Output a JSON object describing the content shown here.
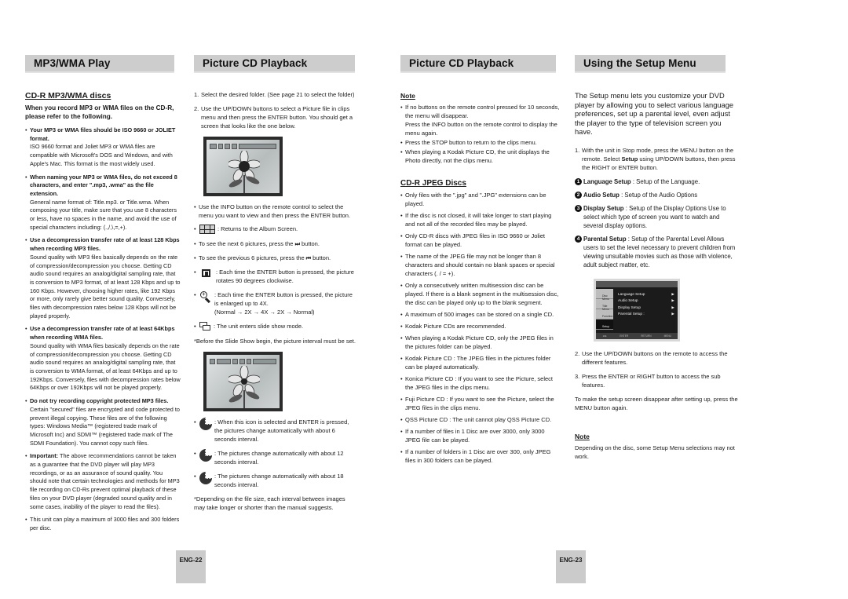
{
  "columns": {
    "mp3wma": {
      "header": "MP3/WMA Play",
      "subheading": "CD-R MP3/WMA discs",
      "lead": "When you record MP3 or WMA files on the CD-R, please refer to the following.",
      "items": [
        {
          "bold": "Your MP3 or WMA files should be ISO 9660 or JOLIET format.",
          "body": "ISO 9660 format and Joliet MP3 or WMA files are compatible with Microsoft's DOS and Windows, and with Apple's Mac. This format is the most widely used."
        },
        {
          "bold": "When naming your MP3 or WMA files, do not exceed 8 characters, and enter \".mp3, .wma\" as the file extension.",
          "body": "General name format of: Title.mp3. or Title.wma. When composing your title, make sure that you use 8 characters or less, have no spaces in the name, and avoid the use of special characters including: (.,/,\\,=,+)."
        },
        {
          "bold": "Use a decompression transfer rate of at least 128 Kbps when recording MP3 files.",
          "body": "Sound quality with MP3 files basically depends on the rate of compression/decompression you choose. Getting CD audio sound requires an analog/digital sampling rate, that is conversion to MP3 format, of at least 128 Kbps and up to 160 Kbps. However, choosing higher rates, like 192 Kbps or more, only rarely give better sound quality. Conversely, files with decompression rates below 128 Kbps will not be played properly."
        },
        {
          "bold": "Use a decompression transfer rate of at least 64Kbps when recording WMA files.",
          "body": "Sound quality with WMA files basically depends on the rate of compression/decompression you choose. Getting CD audio sound requires an analog/digital sampling rate, that is conversion to WMA format, of at least 64Kbps and up to 192Kbps. Conversely, files with decompression rates below 64Kbps or over 192Kbps will not be played properly."
        },
        {
          "bold": "Do not try recording copyright protected MP3 files.",
          "body": "Certain \"secured\" files are encrypted and code protected to prevent illegal copying. These files are of the following types: Windows Media™ (registered trade mark of Microsoft Inc) and SDMI™ (registered trade mark of The SDMI Foundation). You cannot copy such files."
        }
      ],
      "important_label": "Important:",
      "important_text": "The above recommendations cannot be taken as a guarantee that the DVD player will play MP3 recordings, or as an assurance of sound quality. You should note that certain technologies and methods for MP3 file recording on CD-Rs prevent optimal playback of these files on your DVD player (degraded sound quality and in some cases, inability of the player to read the files).",
      "max_text": "This unit can play a maximum of 3000 files and 300 folders per disc."
    },
    "picture_cd_1": {
      "header": "Picture CD Playback",
      "steps": [
        {
          "n": "1.",
          "text": "Select the desired folder. (See page 21 to select the folder)"
        },
        {
          "n": "2.",
          "text": "Use the UP/DOWN buttons to select a Picture file in clips menu and then press the ENTER button. You should get a screen that looks like the one below."
        }
      ],
      "info_text": "Use the INFO button on the remote control to select the menu you want to view and then press the ENTER button.",
      "album_text": ": Returns to the Album Screen.",
      "next_text_a": "To see the next 6 pictures, press the",
      "next_text_b": "button.",
      "prev_text_a": "To see the previous 6 pictures, press the",
      "prev_text_b": "button.",
      "next_glyph": "⏭",
      "prev_glyph": "⏮",
      "rotate_text": ": Each time the ENTER button is pressed, the picture rotates 90 degrees clockwise.",
      "zoom_text": ": Each time the ENTER button is pressed, the picture is enlarged up to 4X.",
      "zoom_seq": "(Normal → 2X → 4X →  2X → Normal)",
      "slide_text": ": The unit enters slide show mode.",
      "slide_note": "*Before the Slide Show begin, the picture interval must be set.",
      "interval_6": ": When this icon is selected and ENTER is pressed, the pictures change automatically with about 6 seconds interval.",
      "interval_12": ": The pictures change automatically with about 12 seconds interval.",
      "interval_18": ": The pictures change automatically with about 18 seconds interval.",
      "interval_note": "*Depending on the file size, each interval between images may take longer or shorter than the manual suggests."
    },
    "picture_cd_2": {
      "header": "Picture CD Playback",
      "note_label": "Note",
      "notes": [
        "If no buttons on the remote control pressed for 10 seconds, the menu will disappear.\nPress the INFO button on the remote control to display the menu again.",
        "Press the STOP button to return to the clips menu.",
        "When playing a Kodak Picture CD, the unit displays the Photo directly, not the clips menu."
      ],
      "jpeg_heading": "CD-R JPEG Discs",
      "jpeg_items": [
        "Only files with the \".jpg\" and \".JPG\" extensions can be played.",
        "If the disc is not closed, it will take longer to start playing and not all of the recorded files may be played.",
        "Only CD-R discs with JPEG files in ISO 9660 or Joliet format can be played.",
        "The name of the JPEG file may not be longer than 8 characters and should contain no blank spaces or special characters (. / = +).",
        "Only a consecutively written multisession disc can be played. If there is a blank segment in the multisession disc, the disc can be played only up to the blank segment.",
        "A maximum of 500 images can be stored on a single CD.",
        "Kodak Picture CDs are recommended.",
        "When playing a Kodak Picture CD, only the JPEG files in the pictures folder can be played.",
        "Kodak Picture CD : The JPEG files in the pictures folder can be played automatically.",
        "Konica Picture CD : If you want to see the Picture, select the JPEG files in the clips menu.",
        "Fuji Picture CD : If you want to see the Picture, select the JPEG files in the clips menu.",
        "QSS Picture CD : The unit cannot play QSS Picture CD.",
        "If a number of files in 1 Disc are over 3000, only 3000 JPEG file can be played.",
        "If a number of folders in 1 Disc are over 300, only JPEG files in 300 folders can be played."
      ]
    },
    "setup": {
      "header": "Using the Setup Menu",
      "intro": "The Setup menu lets you customize your DVD player by allowing you to select various language preferences, set up a parental level, even adjust the player to the type of television screen you have.",
      "step1_a": "With the unit in Stop mode, press the MENU button on the remote. Select",
      "step1_bold": "Setup",
      "step1_b": "using UP/DOWN buttons, then press the RIGHT or ENTER button.",
      "options": [
        {
          "num": "1",
          "name": "Language Setup",
          "desc": ": Setup of the Language."
        },
        {
          "num": "2",
          "name": "Audio Setup",
          "desc": ": Setup of the Audio Options"
        },
        {
          "num": "3",
          "name": "Display Setup",
          "desc": ": Setup of the Display Options Use to select which type of screen you want to watch and several display options."
        },
        {
          "num": "4",
          "name": "Parental Setup",
          "desc": ": Setup of the Parental Level Allows users to set the level necessary to prevent children from viewing unsuitable movies such as those with violence, adult subject matter, etc."
        }
      ],
      "screen": {
        "side": [
          "Disc Menu",
          "Title Menu",
          "Function",
          "Setup"
        ],
        "menu": [
          "Language Setup",
          "Audio Setup",
          "Display Setup",
          "Parental Setup :"
        ],
        "footer": [
          "◄►",
          "ENTER",
          "RETURN",
          "MENU"
        ]
      },
      "step2": "Use the UP/DOWN buttons on the remote to access the different features.",
      "step3": "Press the ENTER or RIGHT button to access the sub features.",
      "closing": "To make the setup screen disappear after setting up, press the MENU button again.",
      "note_label": "Note",
      "note_text": "Depending on the disc, some Setup Menu selections may not work."
    }
  },
  "page_numbers": {
    "left": "ENG-22",
    "right": "ENG-23"
  }
}
